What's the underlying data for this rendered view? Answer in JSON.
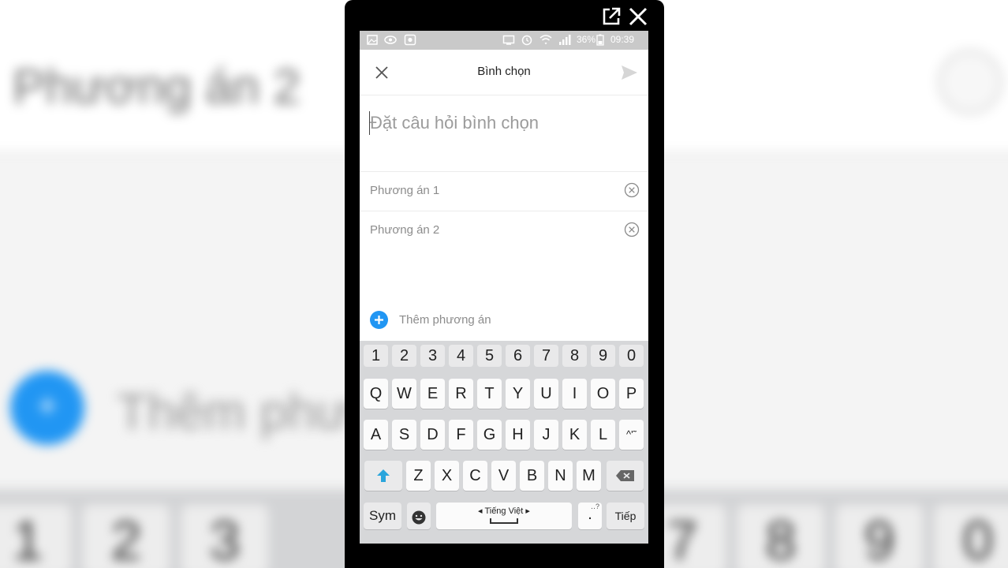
{
  "background": {
    "blurred_title": "Phương án 2",
    "blurred_add_label": "Thêm phương án",
    "blurred_keys": [
      "1",
      "2",
      "3",
      "7",
      "8",
      "9",
      "0"
    ]
  },
  "status_bar": {
    "battery": "36%",
    "time": "09:39"
  },
  "header": {
    "title": "Bình chọn"
  },
  "poll": {
    "question_placeholder": "Đặt câu hỏi bình chọn",
    "options": [
      {
        "label": "Phương án 1"
      },
      {
        "label": "Phương án 2"
      }
    ],
    "add_option_label": "Thêm phương án"
  },
  "keyboard": {
    "number_row": [
      "1",
      "2",
      "3",
      "4",
      "5",
      "6",
      "7",
      "8",
      "9",
      "0"
    ],
    "row1": [
      "Q",
      "W",
      "E",
      "R",
      "T",
      "Y",
      "U",
      "I",
      "O",
      "P"
    ],
    "row2": [
      "A",
      "S",
      "D",
      "F",
      "G",
      "H",
      "J",
      "K",
      "L",
      "^'˜"
    ],
    "row3": [
      "Z",
      "X",
      "C",
      "V",
      "B",
      "N",
      "M"
    ],
    "sym_label": "Sym",
    "language_label": "Tiếng Việt",
    "period_label": ".",
    "next_label": "Tiếp"
  },
  "colors": {
    "accent": "#2196f3",
    "shift_arrow": "#2aa5dc",
    "status_bar": "#c9c9c9"
  }
}
